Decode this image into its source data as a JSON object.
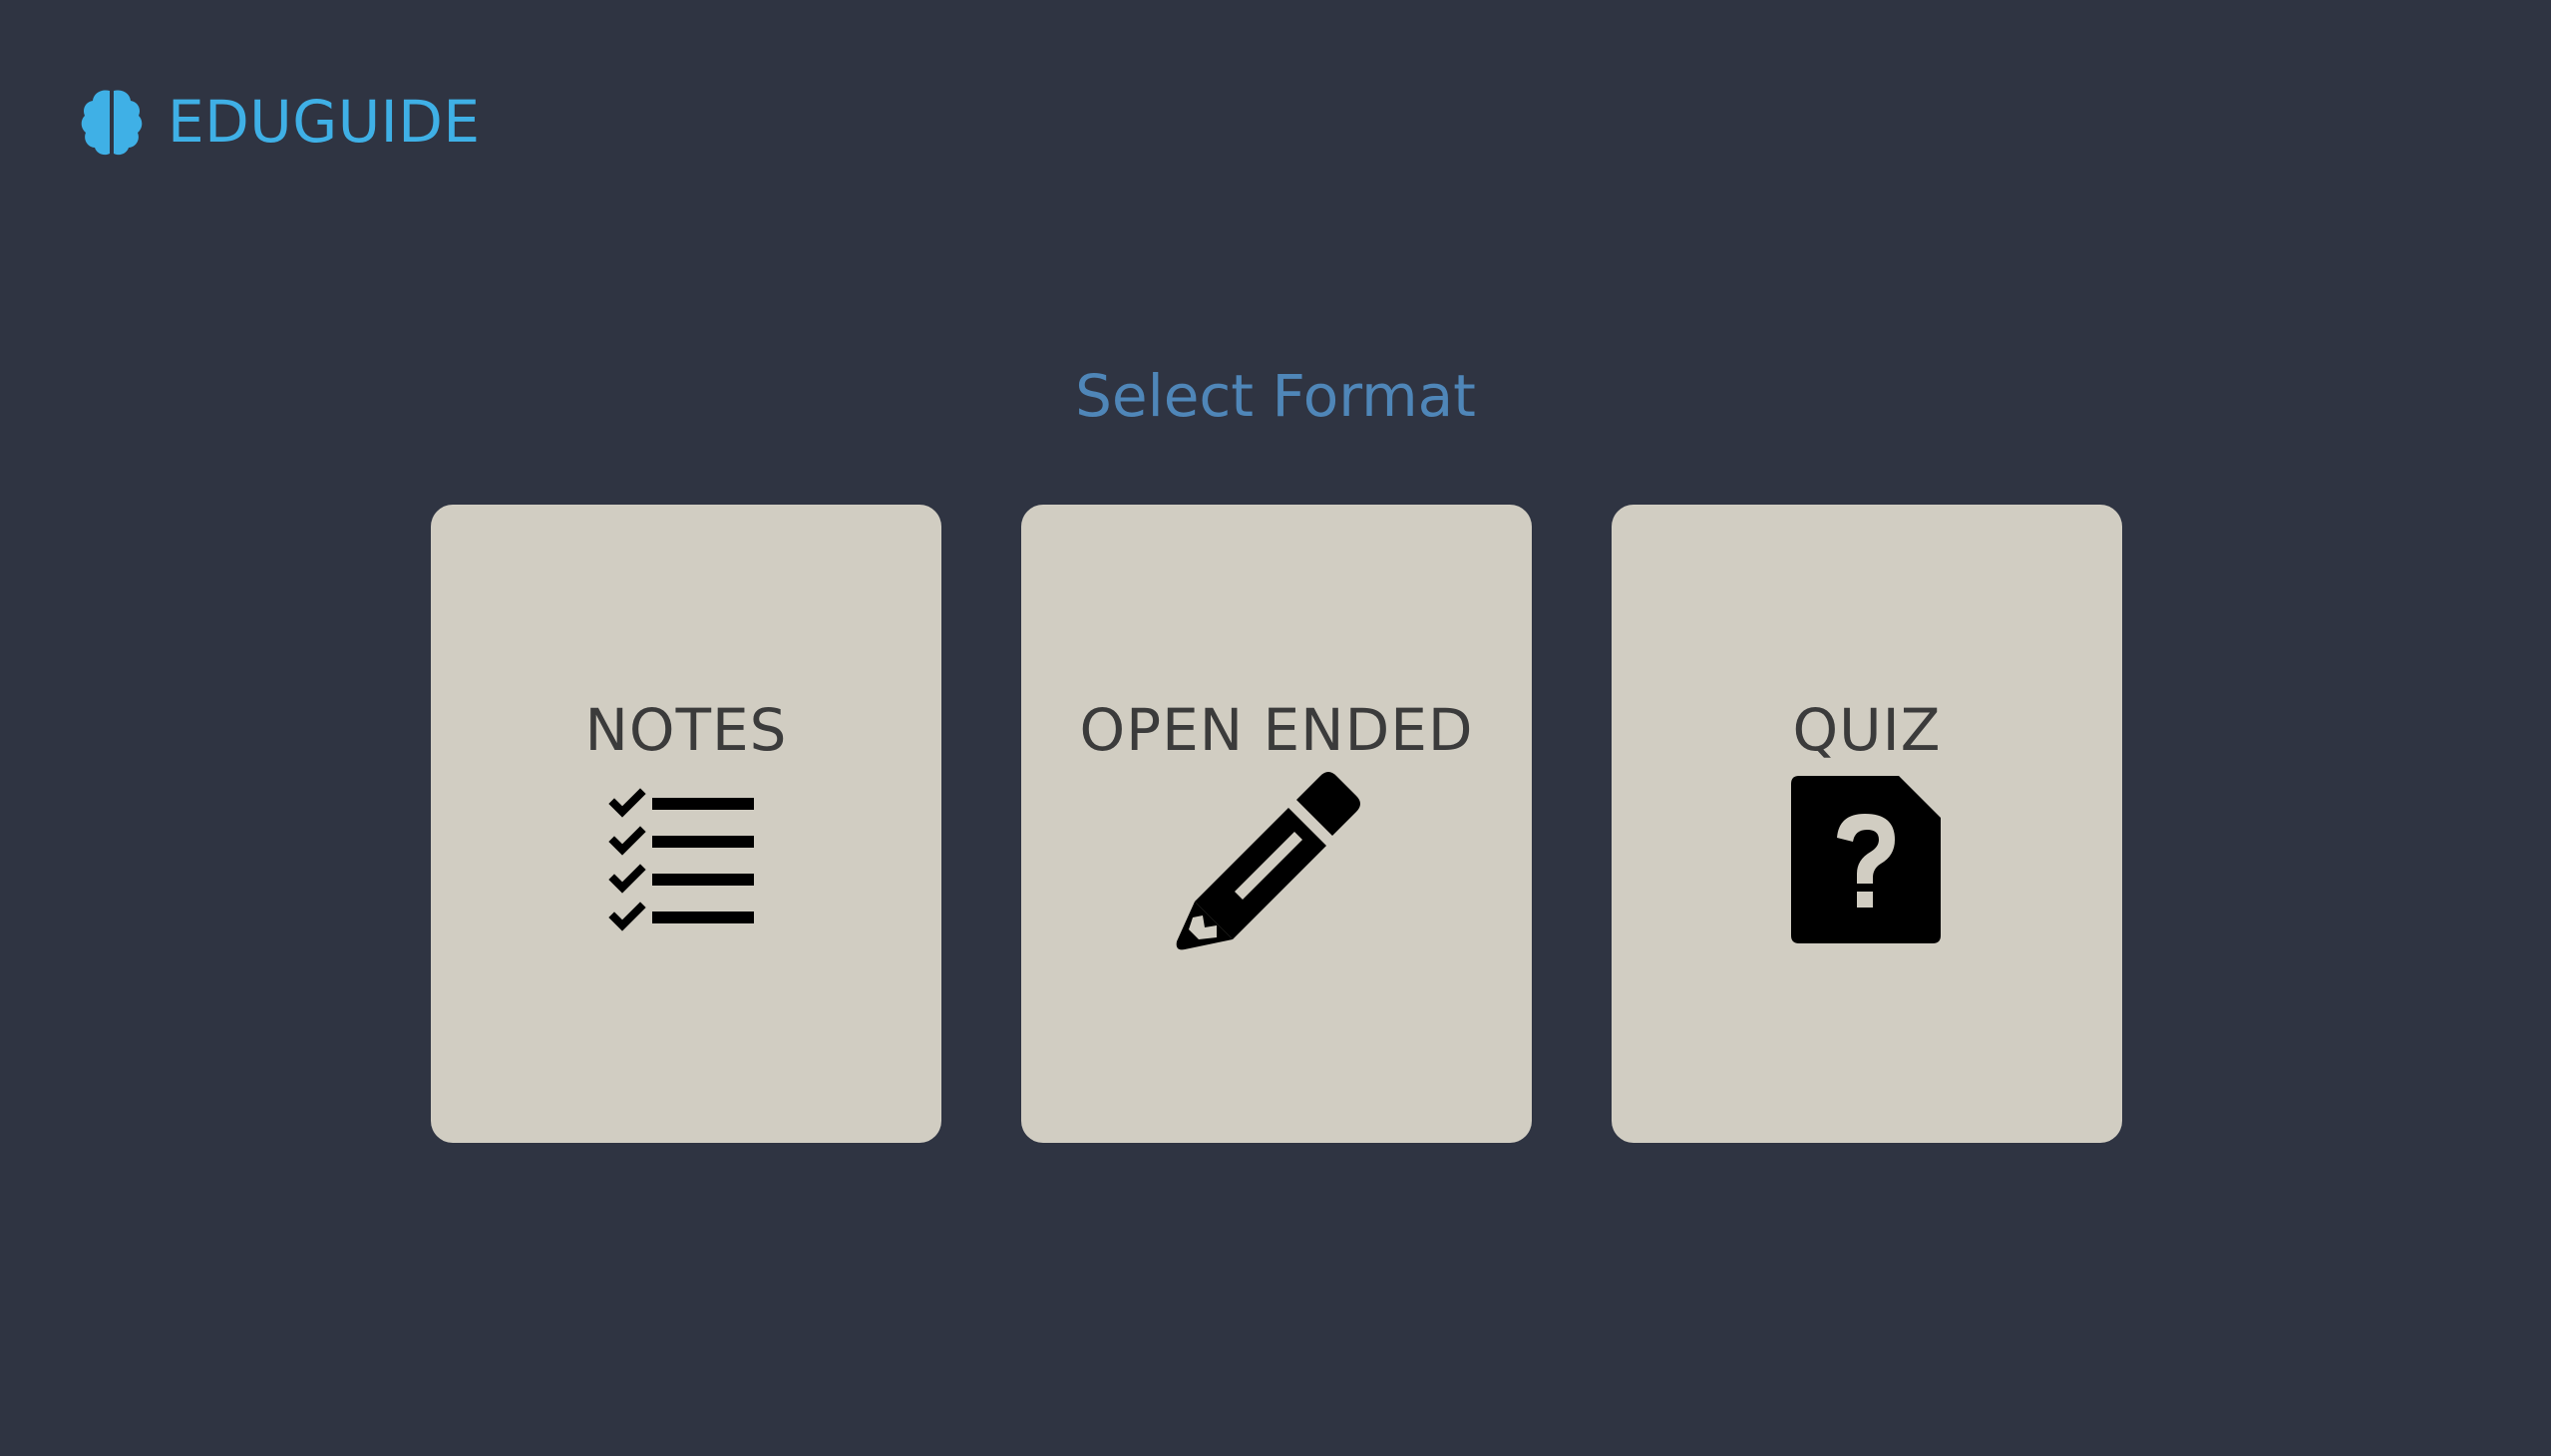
{
  "app": {
    "brand_name": "EDUGUIDE",
    "brand_icon": "brain-icon",
    "accent_color": "#3fb0e6"
  },
  "main": {
    "heading": "Select Format",
    "heading_color": "#4f86b8",
    "formats": [
      {
        "label": "NOTES",
        "icon": "checklist-icon"
      },
      {
        "label": "OPEN ENDED",
        "icon": "pencil-icon"
      },
      {
        "label": "QUIZ",
        "icon": "question-file-icon"
      }
    ],
    "card_color": "#d1cdc2"
  },
  "colors": {
    "background": "#2f3442",
    "card_text": "#3b3b3b",
    "icon": "#000000"
  }
}
